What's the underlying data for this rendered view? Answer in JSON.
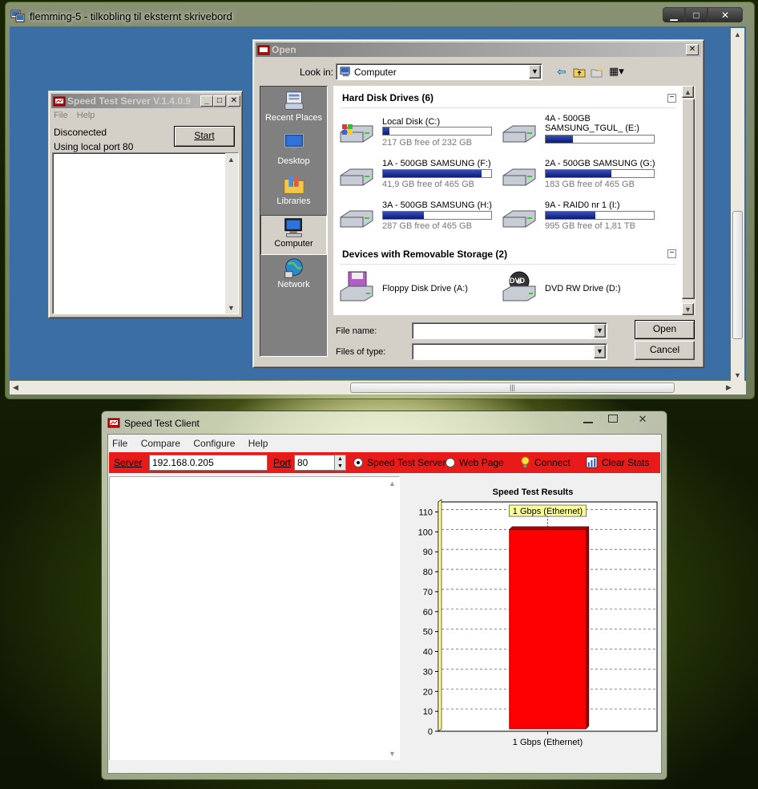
{
  "rdp": {
    "title": "flemming-5 - tilkobling til eksternt skrivebord",
    "btn_min": "▁",
    "btn_max": "□",
    "btn_close": "✕",
    "grip": "|||"
  },
  "server_window": {
    "title": "Speed Test Server V.1.4.0.9",
    "menu": [
      "File",
      "Help"
    ],
    "status": "Disconected",
    "port_text": "Using local port 80",
    "start_label": "Start"
  },
  "open_dialog": {
    "title": "Open",
    "look_in_label": "Look in:",
    "look_in_value": "Computer",
    "places": [
      "Recent Places",
      "Desktop",
      "Libraries",
      "Computer",
      "Network"
    ],
    "hdd_header": "Hard Disk Drives (6)",
    "removable_header": "Devices with Removable Storage (2)",
    "drives": [
      {
        "name": "Local Disk (C:)",
        "free": "217 GB free of 232 GB",
        "used_fraction": 0.06
      },
      {
        "name": "4A - 500GB SAMSUNG_TGUL_ (E:)",
        "free": "",
        "used_fraction": 0.25
      },
      {
        "name": "1A - 500GB SAMSUNG (F:)",
        "free": "41,9 GB free of 465 GB",
        "used_fraction": 0.91
      },
      {
        "name": "2A - 500GB SAMSUNG (G:)",
        "free": "183 GB free of 465 GB",
        "used_fraction": 0.61
      },
      {
        "name": "3A - 500GB SAMSUNG (H:)",
        "free": "287 GB free of 465 GB",
        "used_fraction": 0.38
      },
      {
        "name": "9A - RAID0 nr 1 (I:)",
        "free": "995 GB free of 1,81 TB",
        "used_fraction": 0.46
      }
    ],
    "removable": [
      {
        "name": "Floppy Disk Drive (A:)"
      },
      {
        "name": "DVD RW Drive (D:)"
      }
    ],
    "dvd_badge": "DVD",
    "file_name_label": "File name:",
    "file_name_value": "",
    "files_type_label": "Files of type:",
    "files_type_value": "",
    "open_label": "Open",
    "cancel_label": "Cancel"
  },
  "client_window": {
    "title": "Speed Test Client",
    "menu": [
      "File",
      "Compare",
      "Configure",
      "Help"
    ],
    "server_label": "Server",
    "server_value": "192.168.0.205",
    "port_label": "Port",
    "port_value": "80",
    "opt_speed_test": "Speed Test Server",
    "opt_web_page": "Web Page",
    "connect_label": "Connect",
    "clear_stats_label": "Clear Stats"
  },
  "chart_data": {
    "type": "bar",
    "title": "Speed Test Results",
    "categories": [
      "1 Gbps (Ethernet)"
    ],
    "values": [
      100
    ],
    "annotation": "1 Gbps (Ethernet)",
    "ylim": [
      0,
      115
    ],
    "yticks": [
      0,
      10,
      20,
      30,
      40,
      50,
      60,
      70,
      80,
      90,
      100,
      110
    ],
    "grid": true,
    "bar_color": "#ff0000",
    "annotation_bg": "#ffff99"
  }
}
